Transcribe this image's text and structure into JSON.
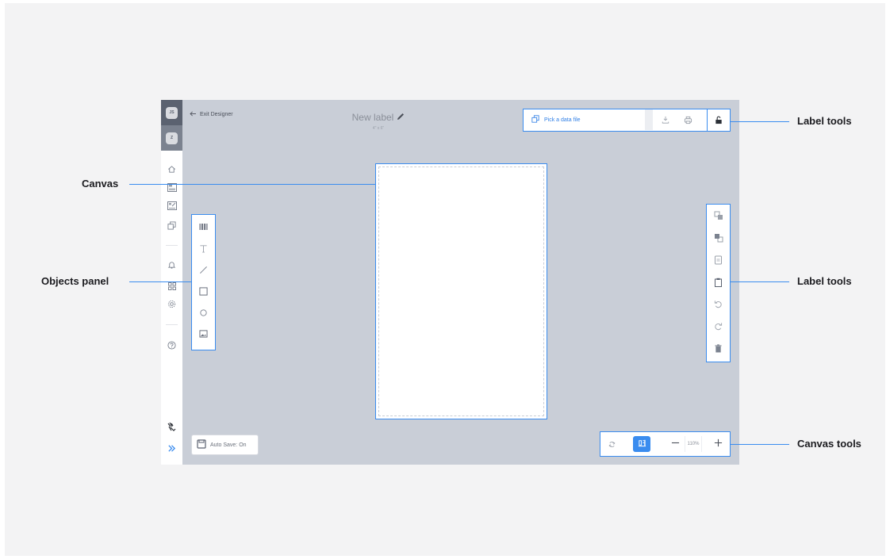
{
  "header": {
    "exit_label": "Exit Designer",
    "title": "New label",
    "subtitle": "4\" x 6\""
  },
  "rail": {
    "user_initials": "JS",
    "org_initial": "Z"
  },
  "data_file": {
    "pick_label": "Pick a data file"
  },
  "footer": {
    "autosave_label": "Auto Save: On",
    "zoom_value": "110%"
  },
  "callouts": {
    "label_tools_top": "Label tools",
    "canvas": "Canvas",
    "objects_panel": "Objects panel",
    "label_tools_side": "Label tools",
    "canvas_tools": "Canvas tools"
  },
  "colors": {
    "accent": "#3a8cef",
    "workspace": "#c9ced7",
    "rail_dark": "#5b6270"
  }
}
